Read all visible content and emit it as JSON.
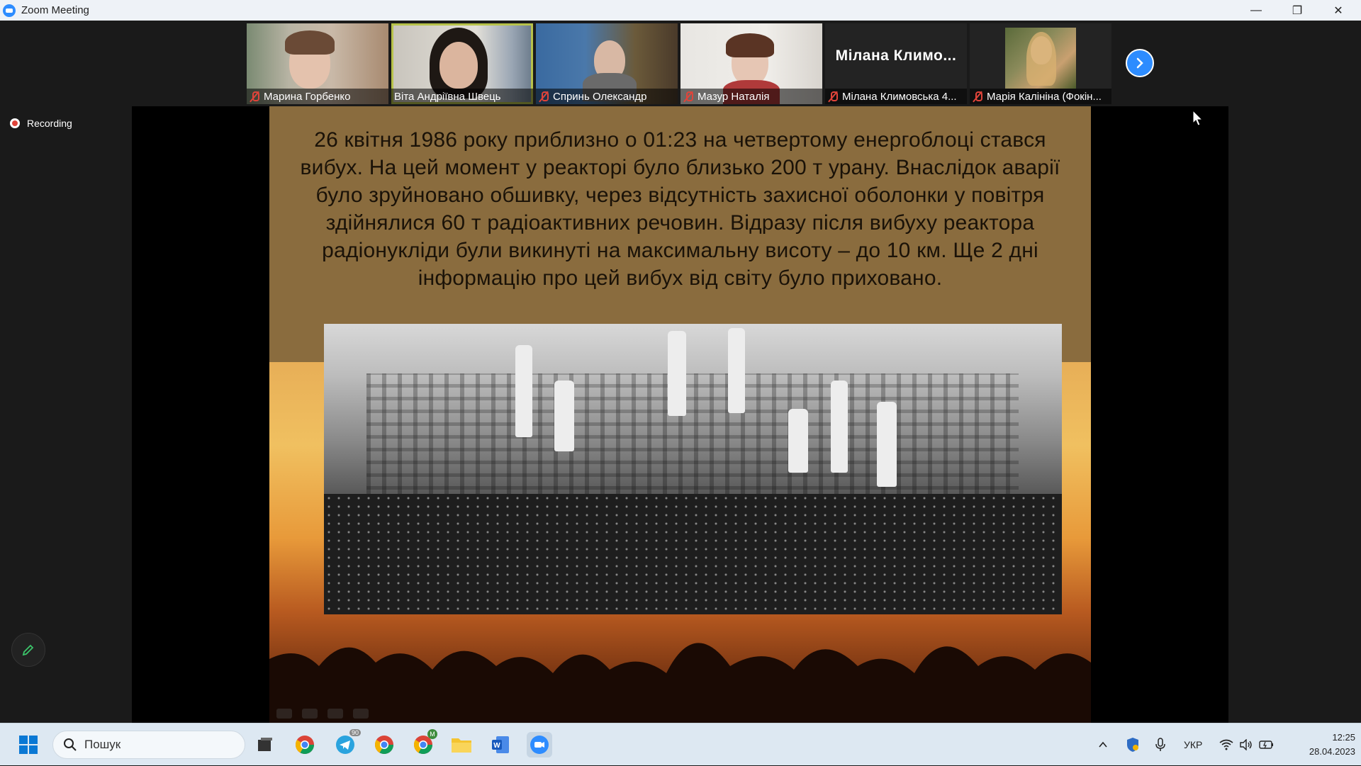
{
  "window": {
    "title": "Zoom Meeting",
    "controls": {
      "minimize": "—",
      "restore": "❐",
      "close": "✕"
    }
  },
  "participants": [
    {
      "name": "Марина Горбенко",
      "muted": true,
      "video": true,
      "active": false
    },
    {
      "name": "Віта Андріївна Швець",
      "muted": false,
      "video": true,
      "active": true
    },
    {
      "name": "Спринь Олександр",
      "muted": true,
      "video": true,
      "active": false
    },
    {
      "name": "Мазур Наталія",
      "muted": true,
      "video": true,
      "active": false
    },
    {
      "name": "Мілана Климовська 4...",
      "muted": true,
      "video": false,
      "active": false,
      "display_name": "Мілана Климо..."
    },
    {
      "name": "Марія Калініна (Фокін...",
      "muted": true,
      "video": true,
      "active": false
    }
  ],
  "recording": {
    "label": "Recording"
  },
  "slide": {
    "text": "26 квітня 1986 року приблизно о 01:23 на четвертому енергоблоці стався вибух. На цей момент у реакторі було близько 200 т урану. Внаслідок аварії було зруйновано обшивку, через відсутність захисної оболонки у повітря здійнялися 60 т радіоактивних речовин. Відразу після вибуху реактора радіонукліди були викинуті на максимальну висоту – до 10 км. Ще 2 дні інформацію про цей вибух від світу було приховано."
  },
  "taskbar": {
    "search_placeholder": "Пошук",
    "telegram_badge": "90",
    "chrome_profile_badge": "M",
    "language": "УКР",
    "time": "12:25",
    "date": "28.04.2023"
  },
  "colors": {
    "zoom_blue": "#2d8cff",
    "mute_red": "#e0443a",
    "active_outline": "#b7c24a",
    "slide_top_bg": "#8a6c3e"
  }
}
